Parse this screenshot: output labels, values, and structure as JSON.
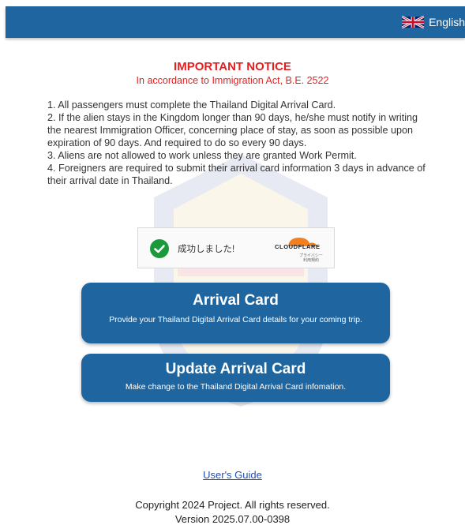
{
  "header": {
    "language_label": "English",
    "flag_icon": "uk-flag-icon",
    "bar_color": "#1f66a0"
  },
  "notice": {
    "title": "IMPORTANT NOTICE",
    "subtitle": "In accordance to Immigration Act, B.E. 2522",
    "rules": [
      "1. All passengers must complete the Thailand Digital Arrival Card.",
      "2. If the alien stays in the Kingdom longer than 90 days, he/she must notify in writing the nearest Immigration Officer, concerning place of stay, as soon as possible upon expiration of 90 days. And required to do so every 90 days.",
      "3. Aliens are not allowed to work unless they are granted Work Permit.",
      "4. Foreigners are required to submit their arrival card information 3 days in advance of their arrival date in Thailand."
    ],
    "title_color": "#e41f1f"
  },
  "captcha": {
    "status_text": "成功しました!",
    "provider": "CLOUDFLARE",
    "links": [
      "プライバシー",
      "利用規約"
    ],
    "status_icon": "check-circle-icon"
  },
  "actions": {
    "arrival": {
      "title": "Arrival Card",
      "description": "Provide your Thailand Digital Arrival Card details for your coming trip."
    },
    "update": {
      "title": "Update Arrival Card",
      "description": "Make change to the Thailand Digital Arrival Card infomation."
    }
  },
  "footer": {
    "guide_link": "User's Guide",
    "copyright": "Copyright 2024 Project. All rights reserved.",
    "version": "Version 2025.07.00-0398"
  }
}
